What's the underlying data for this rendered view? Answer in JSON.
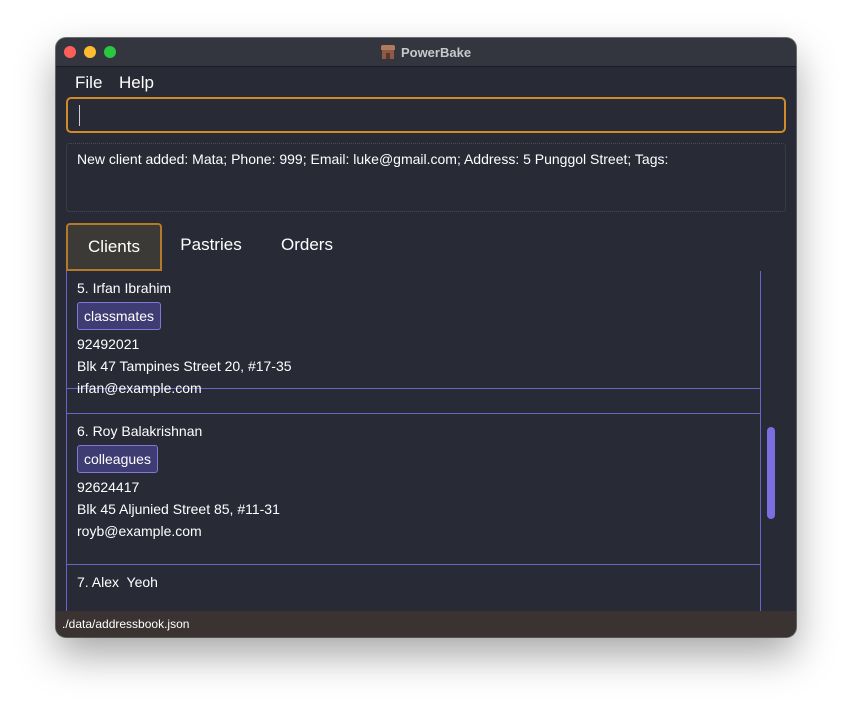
{
  "window": {
    "title": "PowerBake"
  },
  "menu": {
    "items": [
      {
        "label": "File"
      },
      {
        "label": "Help"
      }
    ]
  },
  "command_box": {
    "value": ""
  },
  "result": {
    "text": "New client added: Mata; Phone: 999; Email: luke@gmail.com; Address: 5 Punggol Street; Tags:"
  },
  "tabs": [
    {
      "label": "Clients",
      "selected": true
    },
    {
      "label": "Pastries",
      "selected": false
    },
    {
      "label": "Orders",
      "selected": false
    }
  ],
  "clients": [
    {
      "name": "5. Irfan Ibrahim",
      "tag": "classmates",
      "phone": "92492021",
      "address": "Blk 47 Tampines Street 20, #17-35",
      "email": "irfan@example.com"
    },
    {
      "name": "6. Roy Balakrishnan",
      "tag": "colleagues",
      "phone": "92624417",
      "address": "Blk 45 Aljunied Street 85, #11-31",
      "email": "royb@example.com"
    },
    {
      "name": "7. Alex  Yeoh"
    }
  ],
  "status_bar": {
    "path": "./data/addressbook.json"
  },
  "colors": {
    "window_bg": "#282a36",
    "accent_orange": "#d08a2a",
    "card_border": "#6a64c4",
    "tag_bg": "#3f3c73",
    "scrollbar": "#7a6ee0"
  },
  "icons": [
    "close-icon",
    "minimize-icon",
    "zoom-icon",
    "app-icon"
  ]
}
